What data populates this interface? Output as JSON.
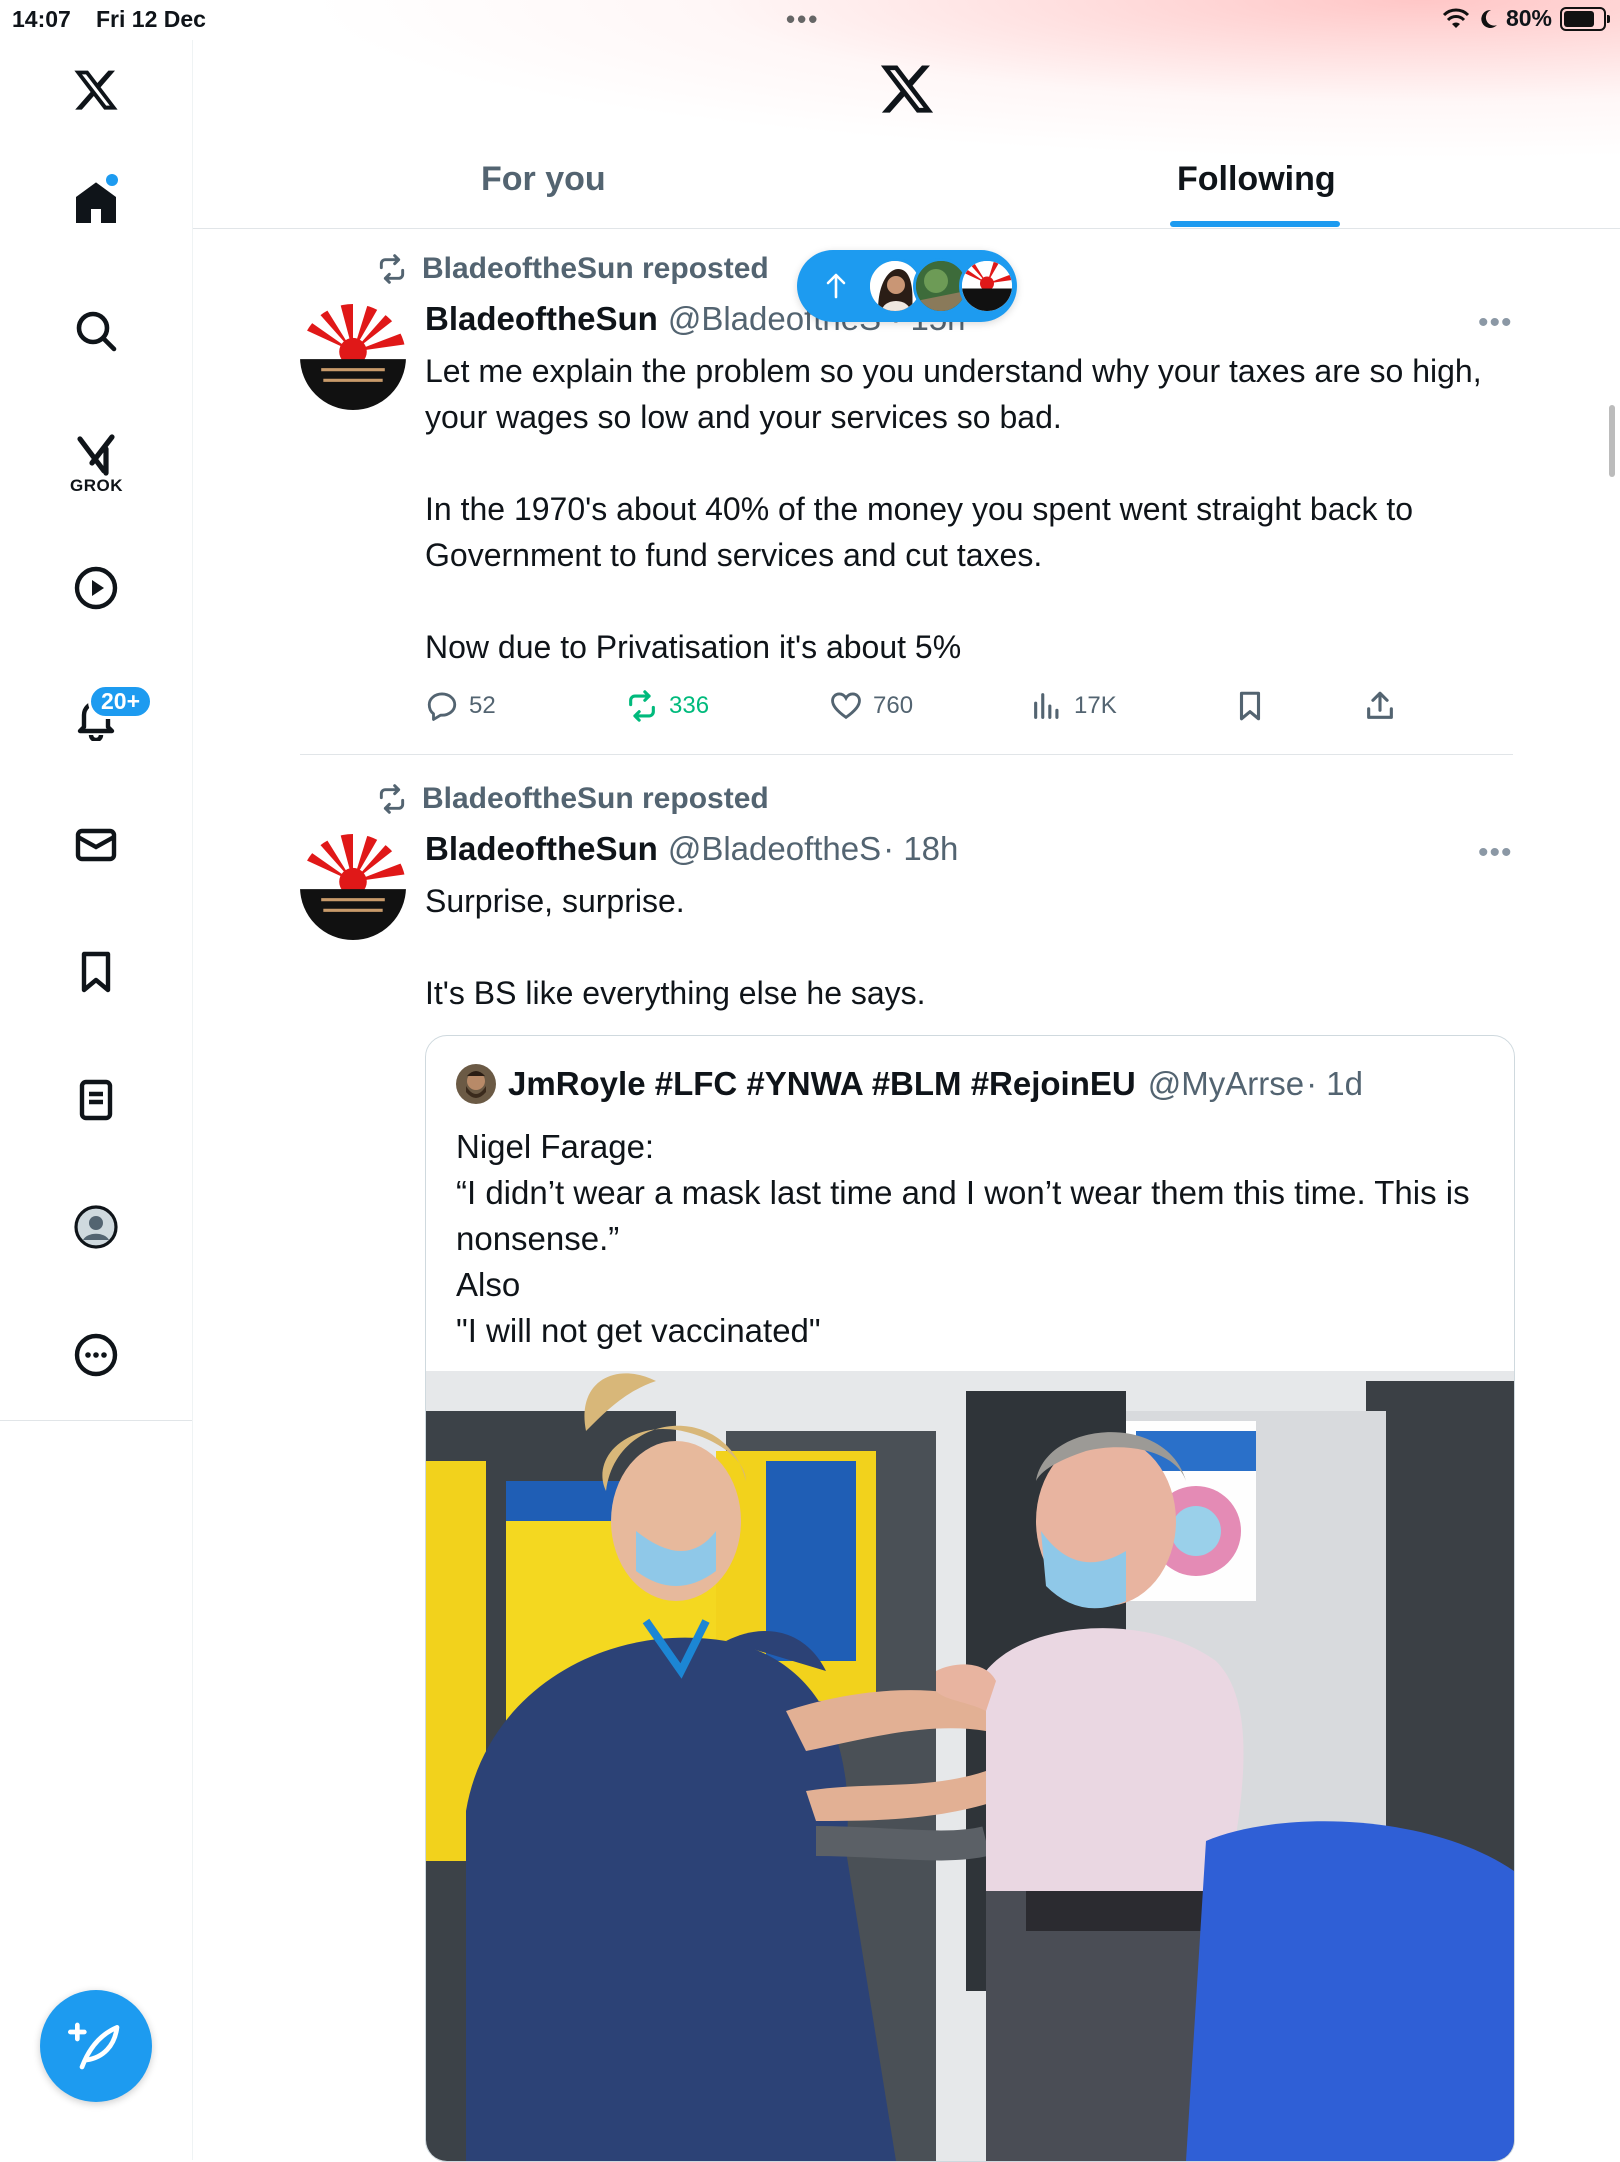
{
  "status_bar": {
    "time": "14:07",
    "date": "Fri 12 Dec",
    "battery": "80%",
    "battery_level": 0.8
  },
  "sidebar": {
    "items": [
      {
        "name": "home",
        "icon": "home-icon"
      },
      {
        "name": "explore",
        "icon": "search-icon"
      },
      {
        "name": "grok",
        "icon": "grok-icon",
        "label": "GROK"
      },
      {
        "name": "video",
        "icon": "play-icon"
      },
      {
        "name": "notifications",
        "icon": "bell-icon",
        "badge": "20+"
      },
      {
        "name": "messages",
        "icon": "mail-icon"
      },
      {
        "name": "bookmarks",
        "icon": "bookmark-icon"
      },
      {
        "name": "lists",
        "icon": "list-icon"
      },
      {
        "name": "profile",
        "icon": "profile-icon"
      },
      {
        "name": "more",
        "icon": "more-icon"
      }
    ],
    "compose_icon": "compose-icon"
  },
  "header": {
    "logo": "x-logo-icon",
    "tabs": [
      {
        "label": "For you",
        "active": false
      },
      {
        "label": "Following",
        "active": true
      }
    ]
  },
  "new_posts_pill": {
    "icon": "arrow-up-icon",
    "avatars": 3
  },
  "posts": [
    {
      "repost_label": "BladeoftheSun reposted",
      "author_name": "BladeoftheSun",
      "author_handle": "@BladeoftheS · 15h",
      "text": "Let me explain the problem so you understand why your taxes are so high, your wages so low and your services so bad.\n\nIn the 1970's about 40% of the money you spent went straight back to Government to fund services and cut taxes.\n\nNow due to Privatisation it's about 5%",
      "replies": "52",
      "reposts": "336",
      "likes": "760",
      "views": "17K"
    },
    {
      "repost_label": "BladeoftheSun reposted",
      "author_name": "BladeoftheSun",
      "author_handle": "@BladeoftheS",
      "time": "· 18h",
      "text": "Surprise, surprise.\n\nIt's BS like everything else he says.",
      "quote": {
        "author_name": "JmRoyle #LFC #YNWA #BLM #RejoinEU",
        "author_handle": "@MyArrse",
        "time": "· 1d",
        "text": "Nigel Farage:\n“I didn’t wear a mask last time and I won’t wear them this time. This is nonsense.”\nAlso\n\"I will not get vaccinated\""
      }
    }
  ],
  "colors": {
    "accent": "#1d9bf0",
    "repost_green": "#00ba7c",
    "muted": "#536471"
  }
}
